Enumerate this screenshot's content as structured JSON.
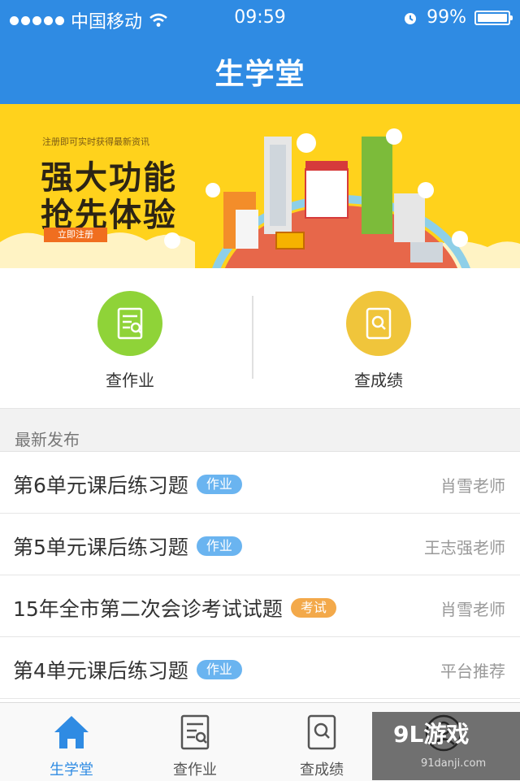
{
  "status_bar": {
    "carrier": "中国移动",
    "time": "09:59",
    "battery": "99%",
    "battery_level": 0.99
  },
  "header": {
    "title": "生学堂"
  },
  "banner": {
    "subtitle": "注册即可实时获得最新资讯",
    "line1": "强大功能",
    "line2": "抢先体验",
    "register_label": "立即注册"
  },
  "actions": [
    {
      "label": "查作业",
      "icon": "homework-icon",
      "color": "#8fd338"
    },
    {
      "label": "查成绩",
      "icon": "search-grade-icon",
      "color": "#f0c53b"
    }
  ],
  "section": {
    "title": "最新发布"
  },
  "list": [
    {
      "title": "第6单元课后练习题",
      "tag": "作业",
      "tag_color": "#6ab4f0",
      "author": "肖雪老师"
    },
    {
      "title": "第5单元课后练习题",
      "tag": "作业",
      "tag_color": "#6ab4f0",
      "author": "王志强老师"
    },
    {
      "title": "15年全市第二次会诊考试试题",
      "tag": "考试",
      "tag_color": "#f3a94a",
      "author": "肖雪老师"
    },
    {
      "title": "第4单元课后练习题",
      "tag": "作业",
      "tag_color": "#6ab4f0",
      "author": "平台推荐"
    }
  ],
  "tabbar": [
    {
      "label": "生学堂",
      "icon": "home-icon",
      "active": true
    },
    {
      "label": "查作业",
      "icon": "homework-icon",
      "active": false
    },
    {
      "label": "查成绩",
      "icon": "search-grade-icon",
      "active": false
    },
    {
      "label": "",
      "icon": "profile-icon",
      "active": false
    }
  ],
  "watermark": {
    "brand": "9L游戏",
    "url": "91danji.com"
  },
  "colors": {
    "primary": "#2f8be3",
    "banner_bg": "#ffd21c"
  }
}
